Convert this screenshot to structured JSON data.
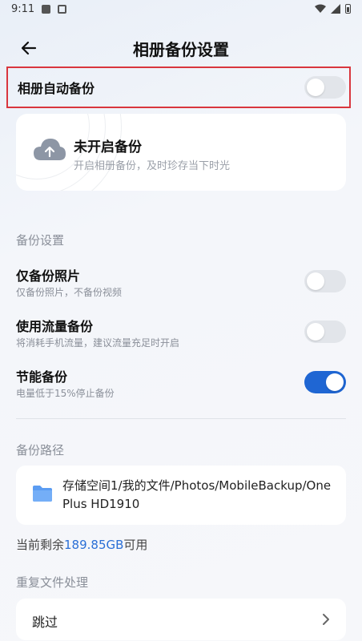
{
  "status_bar": {
    "time": "9:11"
  },
  "header": {
    "title": "相册备份设置"
  },
  "auto_backup": {
    "label": "相册自动备份",
    "enabled": false
  },
  "status_card": {
    "title": "未开启备份",
    "subtitle": "开启相册备份，及时珍存当下时光",
    "icon": "cloud-upload-icon"
  },
  "backup_settings": {
    "section_title": "备份设置",
    "items": [
      {
        "title": "仅备份照片",
        "subtitle": "仅备份照片，不备份视频",
        "enabled": false
      },
      {
        "title": "使用流量备份",
        "subtitle": "将消耗手机流量，建议流量充足时开启",
        "enabled": false
      },
      {
        "title": "节能备份",
        "subtitle": "电量低于15%停止备份",
        "enabled": true
      }
    ]
  },
  "backup_path": {
    "section_title": "备份路径",
    "path": "存储空间1/我的文件/Photos/MobileBackup/OnePlus HD1910",
    "icon": "folder-icon"
  },
  "free_space": {
    "prefix": "当前剩余",
    "amount": "189.85GB",
    "suffix": "可用"
  },
  "duplicate_handling": {
    "section_title": "重复文件处理",
    "value": "跳过"
  },
  "colors": {
    "accent": "#1f66d3",
    "highlight_border": "#d9363e",
    "link": "#2a6fd6"
  }
}
